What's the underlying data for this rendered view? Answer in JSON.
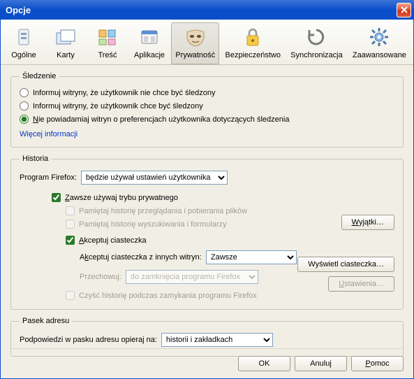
{
  "window": {
    "title": "Opcje"
  },
  "toolbar": {
    "items": [
      {
        "label": "Ogólne"
      },
      {
        "label": "Karty"
      },
      {
        "label": "Treść"
      },
      {
        "label": "Aplikacje"
      },
      {
        "label": "Prywatność"
      },
      {
        "label": "Bezpieczeństwo"
      },
      {
        "label": "Synchronizacja"
      },
      {
        "label": "Zaawansowane"
      }
    ]
  },
  "tracking": {
    "legend": "Śledzenie",
    "opt_do_not_track": "Informuj witryny, że użytkownik nie chce być śledzony",
    "opt_track": "Informuj witryny, że użytkownik chce być śledzony",
    "opt_no_inform": "Nie powiadamiaj witryn o preferencjach użytkownika dotyczących śledzenia",
    "more_info": "Więcej informacji"
  },
  "history": {
    "legend": "Historia",
    "program_label": "Program Firefox:",
    "mode_options": [
      "będzie używał ustawień użytkownika"
    ],
    "always_private": "Zawsze używaj trybu prywatnego",
    "remember_browsing": "Pamiętaj historię przeglądania i pobierania plików",
    "remember_search": "Pamiętaj historię wyszukiwania i formularzy",
    "accept_cookies": "Akceptuj ciasteczka",
    "exceptions_btn": "Wyjątki…",
    "third_party_label": "Akceptuj ciasteczka z innych witryn:",
    "third_party_value": "Zawsze",
    "keep_until_label": "Przechowuj:",
    "keep_until_value": "do zamknięcia programu Firefox",
    "show_cookies_btn": "Wyświetl ciasteczka…",
    "clear_on_close": "Czyść historię podczas zamykania programu Firefox",
    "settings_btn": "Ustawienia…"
  },
  "locationbar": {
    "legend": "Pasek adresu",
    "suggest_label": "Podpowiedzi w pasku adresu opieraj na:",
    "suggest_value": "historii i zakładkach"
  },
  "footer": {
    "ok": "OK",
    "cancel": "Anuluj",
    "help": "Pomoc"
  }
}
